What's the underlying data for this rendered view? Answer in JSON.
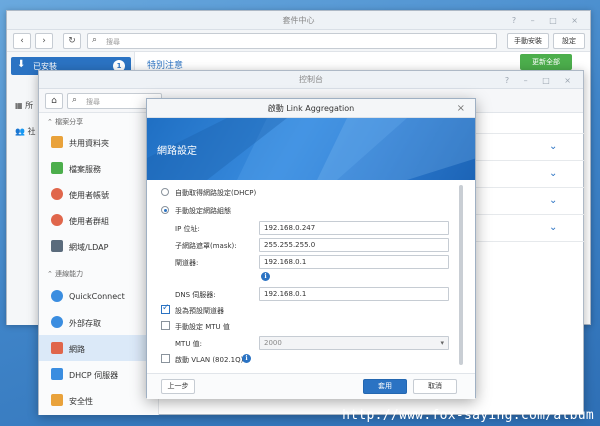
{
  "package_center": {
    "title": "套件中心",
    "toolbar": {
      "back": "‹",
      "forward": "›",
      "refresh": "↻",
      "search_placeholder": "搜尋",
      "manual_install": "手動安裝",
      "settings": "設定"
    },
    "sidebar": {
      "installed_label": "已安裝",
      "installed_badge": "1",
      "row2_label": "所",
      "row3_label": "社"
    },
    "main_title": "特別注意",
    "update_all": "更新全部"
  },
  "control_panel": {
    "title": "控制台",
    "search_placeholder": "搜尋",
    "sections": [
      {
        "label": "檔案分享",
        "items": [
          {
            "label": "共用資料夾",
            "icon": "shared-folder-icon",
            "color": "#e9a23b"
          },
          {
            "label": "檔案服務",
            "icon": "file-services-icon",
            "color": "#4cae4c"
          },
          {
            "label": "使用者帳號",
            "icon": "user-icon",
            "color": "#e0664b"
          },
          {
            "label": "使用者群組",
            "icon": "group-icon",
            "color": "#e0664b"
          },
          {
            "label": "網域/LDAP",
            "icon": "domain-ldap-icon",
            "color": "#5a6b7c"
          }
        ]
      },
      {
        "label": "連線能力",
        "items": [
          {
            "label": "QuickConnect",
            "icon": "quickconnect-icon",
            "color": "#3a8de0"
          },
          {
            "label": "外部存取",
            "icon": "external-access-icon",
            "color": "#3a8de0"
          },
          {
            "label": "網路",
            "icon": "network-icon",
            "color": "#e0664b",
            "active": true
          },
          {
            "label": "DHCP 伺服器",
            "icon": "dhcp-server-icon",
            "color": "#3a8de0"
          },
          {
            "label": "安全性",
            "icon": "security-icon",
            "color": "#e9a23b"
          }
        ]
      }
    ]
  },
  "dialog": {
    "title": "啟動 Link Aggregation",
    "close": "×",
    "hero_title": "網路設定",
    "options": {
      "dhcp": "自動取得網路設定(DHCP)",
      "manual": "手動設定網路組態"
    },
    "fields": {
      "ip_label": "IP 位址:",
      "ip_value": "192.168.0.247",
      "mask_label": "子網路遮罩(mask):",
      "mask_value": "255.255.255.0",
      "gateway_label": "閘道器:",
      "gateway_value": "192.168.0.1",
      "dns_label": "DNS 伺服器:",
      "dns_value": "192.168.0.1"
    },
    "checks": {
      "default_gateway": "設為預設閘道器",
      "manual_mtu": "手動設定 MTU 值",
      "mtu_label": "MTU 值:",
      "mtu_value": "2000",
      "vlan": "啟動 VLAN (802.1Q)"
    },
    "footer": {
      "prev": "上一步",
      "apply": "套用",
      "cancel": "取消"
    }
  },
  "watermark": "http://www.fox-saying.com/album"
}
